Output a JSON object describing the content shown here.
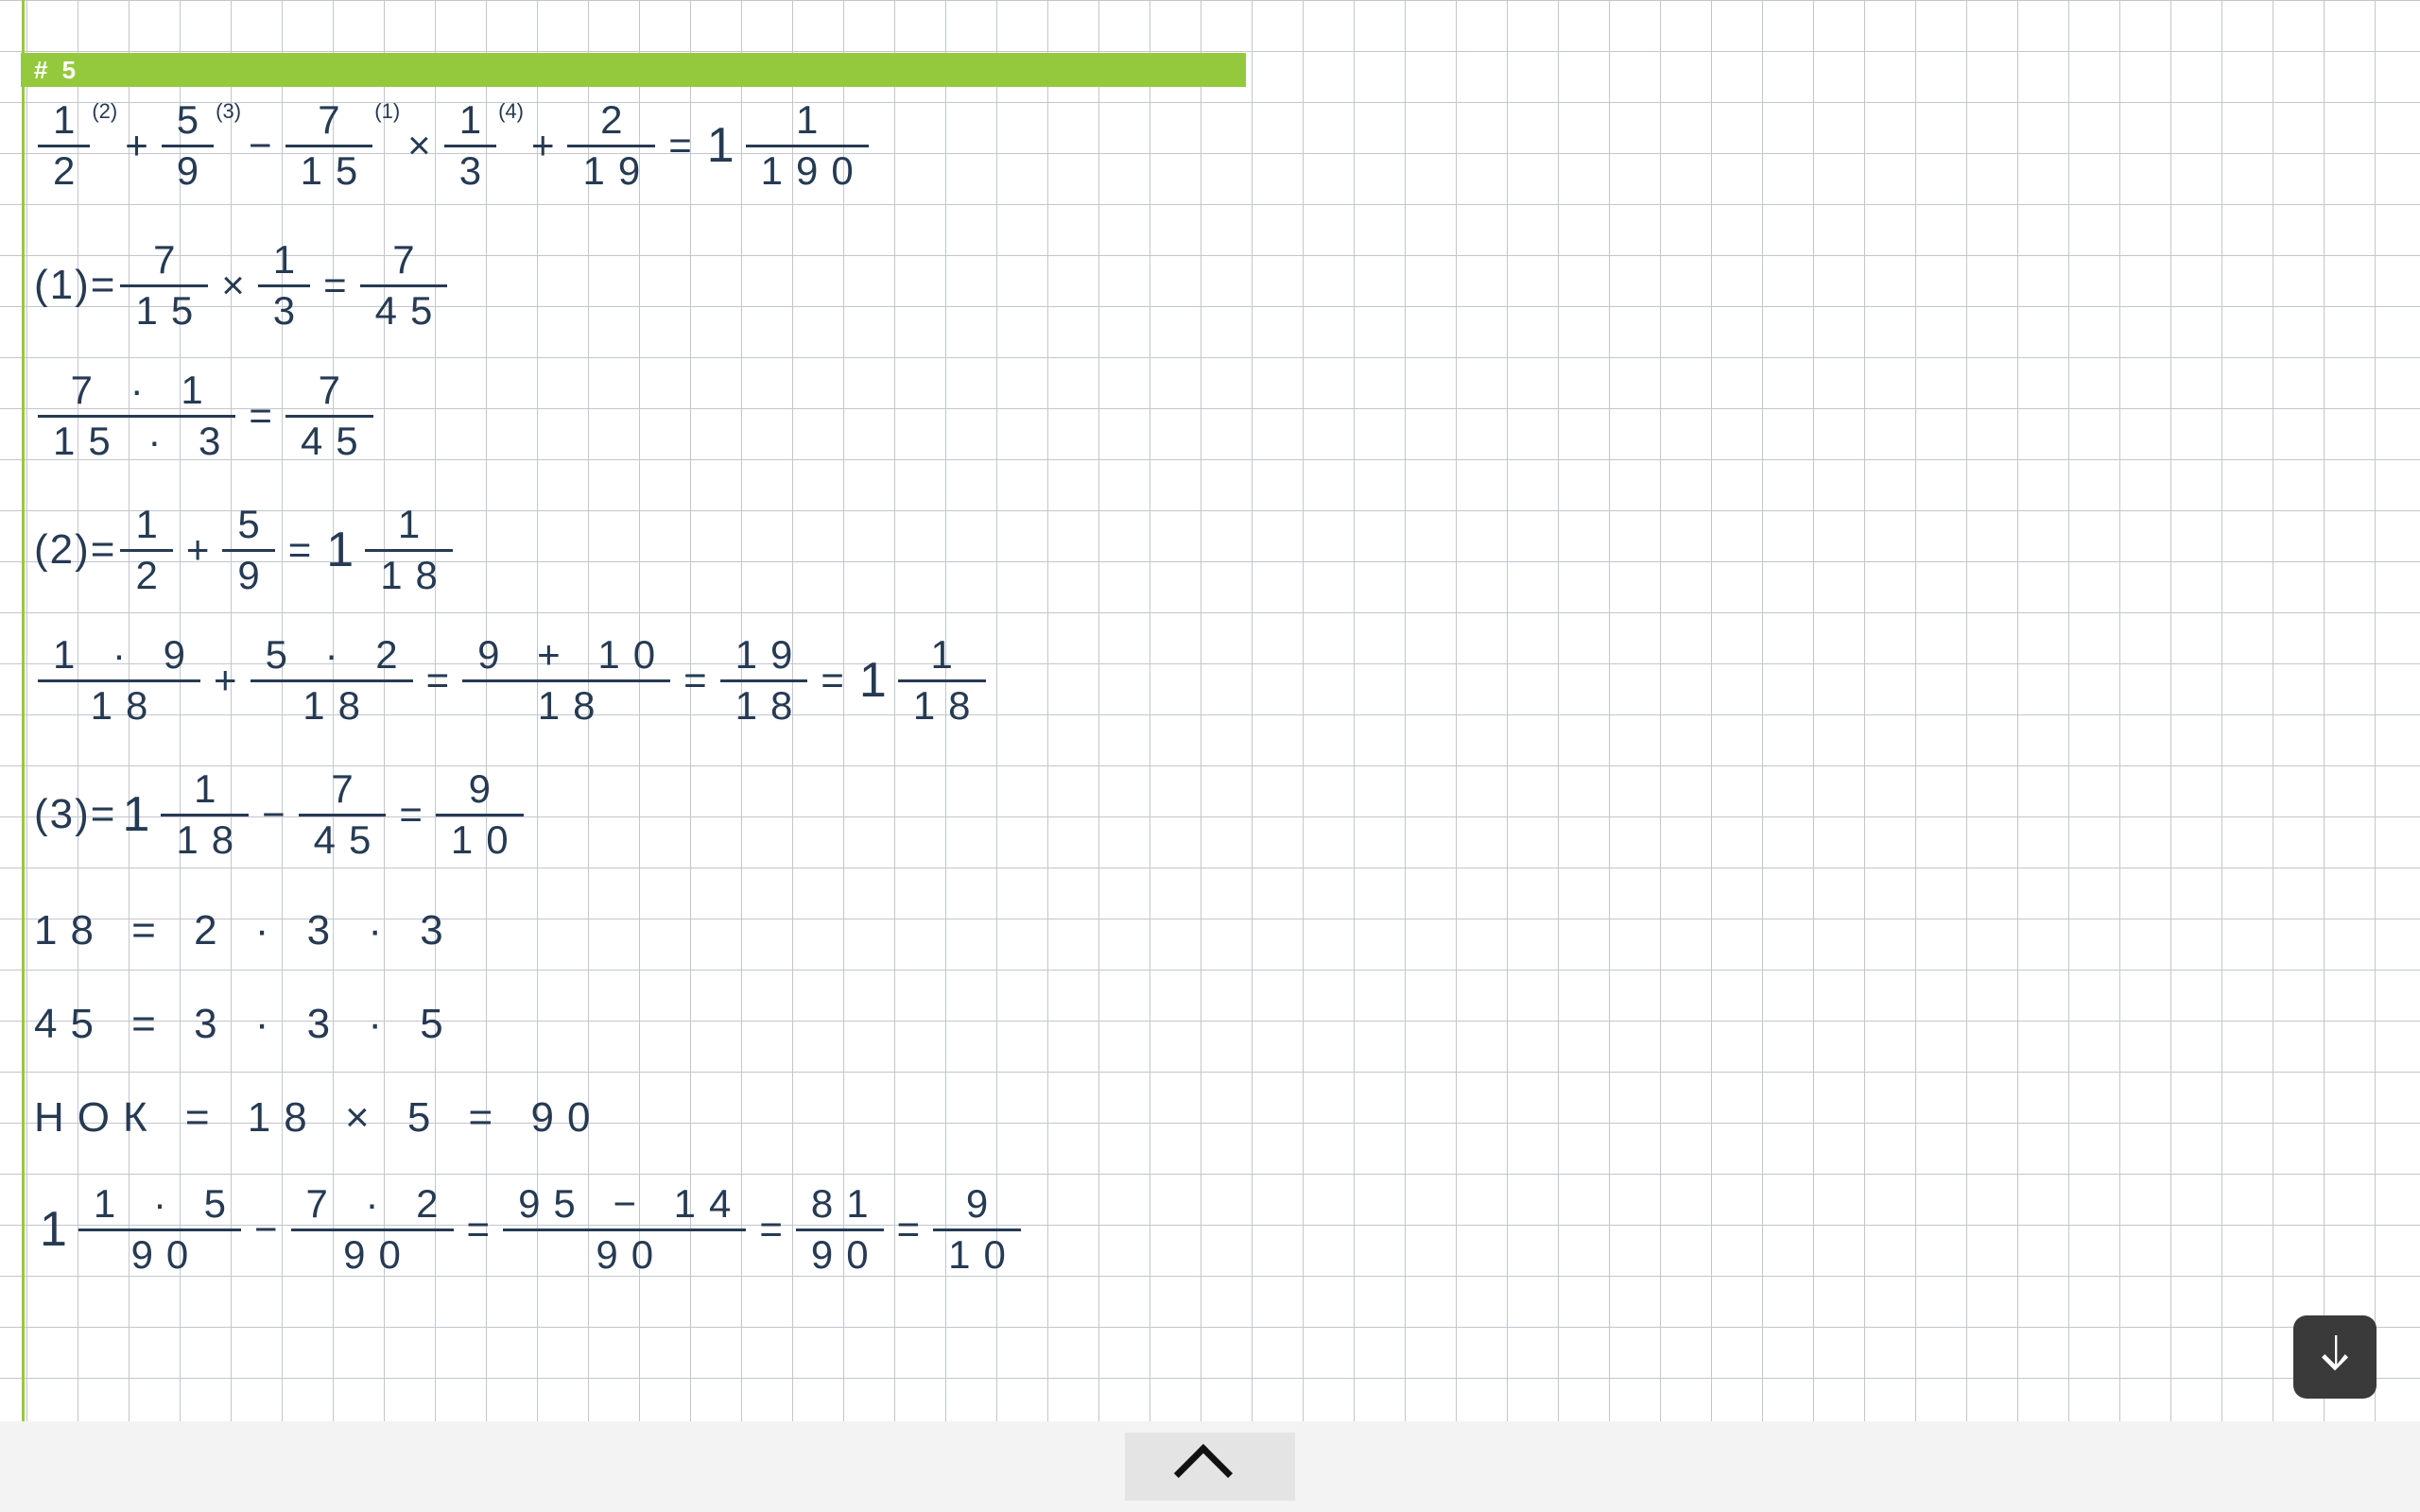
{
  "colors": {
    "accent": "#95c93d",
    "ink": "#263a53"
  },
  "section": {
    "label": "#  5"
  },
  "lines": {
    "l1": {
      "sup2": "(2)",
      "sup3": "(3)",
      "sup1": "(1)",
      "sup4": "(4)",
      "f1n": "1",
      "f1d": "2",
      "p1": "+",
      "f2n": "5",
      "f2d": "9",
      "m1": "−",
      "f3n": "7",
      "f3d": "15",
      "x1": "×",
      "f4n": "1",
      "f4d": "3",
      "p2": "+",
      "f5n": "2",
      "f5d": "19",
      "eq": "=",
      "whole": "1",
      "f6n": "1",
      "f6d": "190"
    },
    "l2": {
      "lead": "(1)=",
      "f1n": "7",
      "f1d": "15",
      "x": "×",
      "f2n": "1",
      "f2d": "3",
      "eq": "=",
      "f3n": "7",
      "f3d": "45"
    },
    "l3": {
      "f1n": "7 · 1",
      "f1d": "15 · 3",
      "eq": "=",
      "f2n": "7",
      "f2d": "45"
    },
    "l4": {
      "lead": "(2)=",
      "f1n": "1",
      "f1d": "2",
      "p": "+",
      "f2n": "5",
      "f2d": "9",
      "eq": "=",
      "whole": "1",
      "f3n": "1",
      "f3d": "18"
    },
    "l5": {
      "f1n": "1 · 9",
      "f1d": "18",
      "p": "+",
      "f2n": "5 · 2",
      "f2d": "18",
      "eq1": "=",
      "f3n": "9 + 10",
      "f3d": "18",
      "eq2": "=",
      "f4n": "19",
      "f4d": "18",
      "eq3": "=",
      "whole": "1",
      "f5n": "1",
      "f5d": "18"
    },
    "l6": {
      "lead": "(3)=",
      "whole1": "1",
      "f1n": "1",
      "f1d": "18",
      "m": "−",
      "f2n": "7",
      "f2d": "45",
      "eq": "=",
      "f3n": "9",
      "f3d": "10"
    },
    "l7": {
      "text": "18 = 2 · 3 · 3"
    },
    "l8": {
      "text": "45 = 3 · 3 · 5"
    },
    "l9": {
      "text": "НОК = 18 × 5 = 90"
    },
    "l10": {
      "whole1": "1",
      "f1n": "1 · 5",
      "f1d": "90",
      "m": "−",
      "f2n": "7 · 2",
      "f2d": "90",
      "eq1": "=",
      "f3n": "95 − 14",
      "f3d": "90",
      "eq2": "=",
      "f4n": "81",
      "f4d": "90",
      "eq3": "=",
      "f5n": "9",
      "f5d": "10"
    }
  }
}
